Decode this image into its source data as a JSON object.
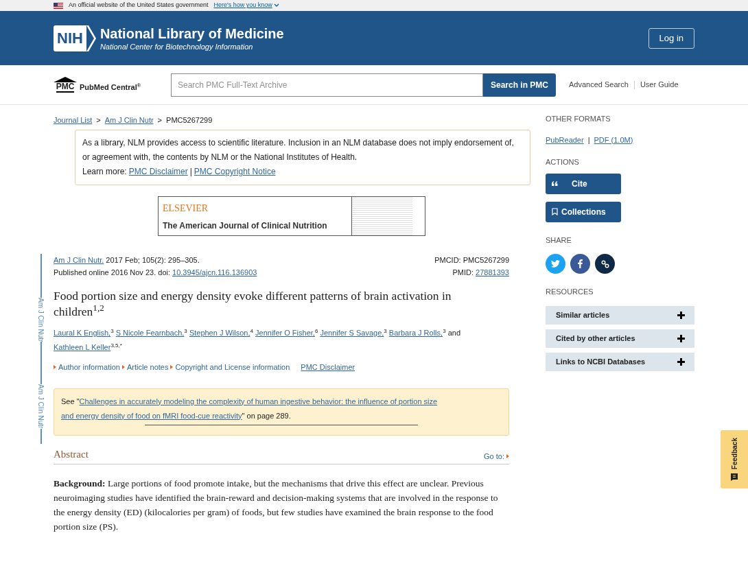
{
  "gov_banner": {
    "text": "An official website of the United States government",
    "link": "Here's how you know"
  },
  "header": {
    "title": "National Library of Medicine",
    "subtitle": "National Center for Biotechnology Information",
    "login": "Log in",
    "logo": "NIH"
  },
  "pmc_bar": {
    "logo": "PMC",
    "brand": "PubMed Central",
    "brand_mark": "®",
    "search_placeholder": "Search PMC Full-Text Archive",
    "search_button": "Search in PMC",
    "links": [
      "Advanced Search",
      "User Guide"
    ]
  },
  "breadcrumb_separator": ">",
  "link_separator": "|",
  "breadcrumb": [
    {
      "label": "Journal List",
      "link": true
    },
    {
      "label": "Am J Clin Nutr",
      "link": true
    },
    {
      "label": "PMC5267299",
      "link": false
    }
  ],
  "disclaimer": {
    "text": "As a library, NLM provides access to scientific literature. Inclusion in an NLM database does not imply endorsement of, or agreement with, the contents by NLM or the National Institutes of Health.",
    "learn_more": "Learn more:",
    "links": [
      "PMC Disclaimer",
      "PMC Copyright Notice"
    ]
  },
  "journal_banner": {
    "publisher": "ELSEVIER",
    "journal": "The American Journal of Clinical Nutrition"
  },
  "side_labels": [
    "Am J Clin Nutr",
    "Am J Clin Nutr"
  ],
  "citation": {
    "journal": "Am J Clin Nutr.",
    "issue": "2017 Feb; 105(2): 295–305.",
    "published": "Published online 2016 Nov 23. doi:",
    "doi": "10.3945/ajcn.116.136903",
    "pmcid": "PMCID: PMC5267299",
    "pmid_label": "PMID:",
    "pmid": "27881393"
  },
  "title": "Food portion size and energy density evoke different patterns of brain activation in children$^{1,2}$",
  "authors": [
    {
      "name": "Laural K English,",
      "sup": "3"
    },
    {
      "name": "S Nicole Fearnbach,",
      "sup": "3"
    },
    {
      "name": "Stephen J Wilson,",
      "sup": "4"
    },
    {
      "name": "Jennifer O Fisher,",
      "sup": "6"
    },
    {
      "name": "Jennifer S Savage,",
      "sup": "3"
    },
    {
      "name": "Barbara J Rolls,",
      "sup": "3"
    },
    {
      "name": "Kathleen L Keller",
      "sup": "3,5,*"
    }
  ],
  "authors_conjunction": "and",
  "info_links": [
    {
      "label": "Author information",
      "kind": "toggle"
    },
    {
      "label": "Article notes",
      "kind": "toggle"
    },
    {
      "label": "Copyright and License information",
      "kind": "toggle"
    },
    {
      "label": "PMC Disclaimer",
      "kind": "link"
    }
  ],
  "see_also": {
    "prefix": "See \"",
    "link_lines": [
      "Challenges in accurately modeling the complexity of human ingestive behavior: the influence of portion size",
      "and energy density of food on fMRI food-cue reactivity"
    ],
    "suffix": "\" on page 289."
  },
  "abstract": {
    "heading": "Abstract",
    "goto": "Go to:",
    "paragraphs": [
      "**Background:** Large portions of food promote intake, but the mechanisms that drive this effect are unclear. Previous neuroimaging studies have identified the brain-reward and decision-making systems that are involved in the response to the energy density (ED) (kilocalories per gram) of foods, but few studies have examined the brain response to the food portion size (PS)."
    ]
  },
  "sidebar": {
    "other_formats": {
      "heading": "OTHER FORMATS",
      "links": [
        "PubReader",
        "PDF (1.0M)"
      ]
    },
    "actions": {
      "heading": "ACTIONS",
      "buttons": [
        {
          "label": "Cite",
          "kind": "cite"
        },
        {
          "label": "Collections",
          "kind": "collections"
        }
      ]
    },
    "share": {
      "heading": "SHARE",
      "buttons": [
        {
          "kind": "twitter"
        },
        {
          "kind": "facebook"
        },
        {
          "kind": "link"
        }
      ]
    },
    "resources": {
      "heading": "RESOURCES",
      "items": [
        {
          "label": "Similar articles",
          "expanded": false
        },
        {
          "label": "Cited by other articles",
          "expanded": false
        },
        {
          "label": "Links to NCBI Databases",
          "expanded": false
        }
      ]
    }
  },
  "feedback": "Feedback"
}
